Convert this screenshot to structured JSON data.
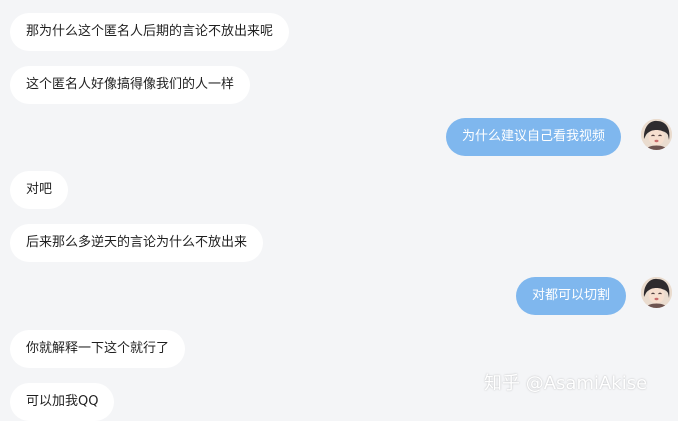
{
  "chat": {
    "messages": [
      {
        "side": "left",
        "text": "那为什么这个匿名人后期的言论不放出来呢"
      },
      {
        "side": "left",
        "text": "这个匿名人好像搞得像我们的人一样"
      },
      {
        "side": "right",
        "text": "为什么建议自己看我视频"
      },
      {
        "side": "left",
        "text": "对吧"
      },
      {
        "side": "left",
        "text": "后来那么多逆天的言论为什么不放出来"
      },
      {
        "side": "right",
        "text": "对都可以切割"
      },
      {
        "side": "left",
        "text": "你就解释一下这个就行了"
      },
      {
        "side": "left",
        "text": "可以加我QQ"
      }
    ]
  },
  "watermark": {
    "text": "知乎 @AsamiAkise"
  },
  "colors": {
    "background": "#f4f5f7",
    "incoming_bubble": "#ffffff",
    "outgoing_bubble": "#7fb7ee"
  }
}
